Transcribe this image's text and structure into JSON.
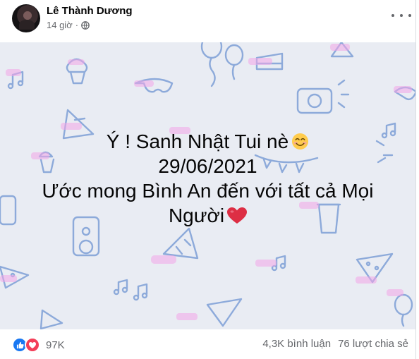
{
  "post": {
    "author": "Lê Thành Dương",
    "time": "14 giờ",
    "privacy_icon": "globe-icon",
    "text": {
      "line1": "Ý ! Sanh Nhật Tui nè",
      "line2": "29/06/2021",
      "line3": "Ước mong Bình An đến với tất cả Mọi",
      "line4": "Người"
    },
    "background_color": "#e9ecf3"
  },
  "footer": {
    "reaction_icons": [
      "like-icon",
      "love-icon"
    ],
    "reaction_count": "97K",
    "comments": "4,3K bình luận",
    "shares": "76 lượt chia sẻ"
  },
  "colors": {
    "accent_blue": "#1877f2",
    "love_red": "#f33e58",
    "pattern_blue": "#7d9fd6",
    "pattern_pink": "#f3a6e8"
  }
}
